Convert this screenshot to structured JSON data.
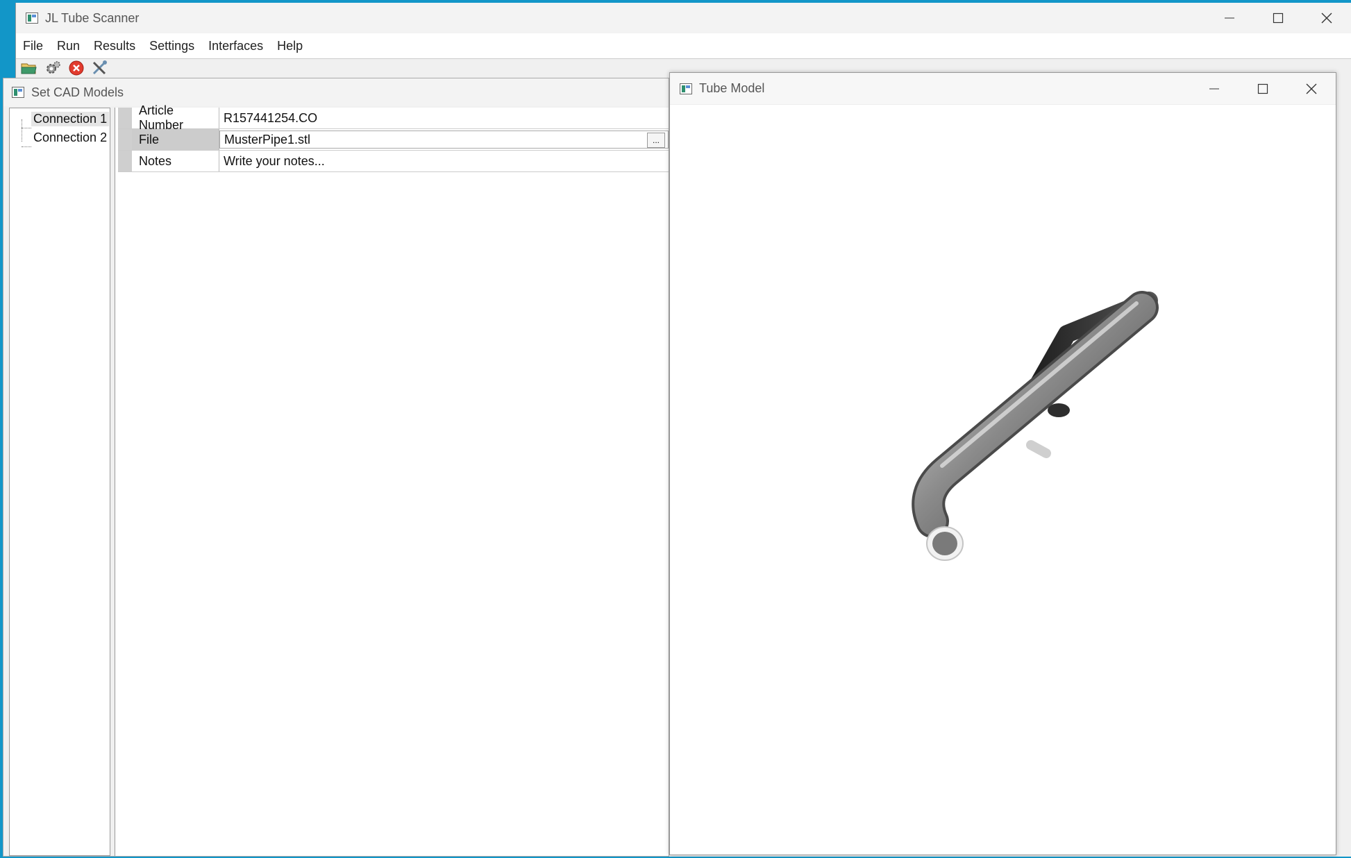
{
  "main_window": {
    "title": "JL Tube Scanner",
    "menu": [
      "File",
      "Run",
      "Results",
      "Settings",
      "Interfaces",
      "Help"
    ],
    "toolbar": [
      "open-folder-icon",
      "settings-gears-icon",
      "stop-icon",
      "tools-icon"
    ]
  },
  "cad_dialog": {
    "title": "Set CAD Models",
    "connections": [
      "Connection 1",
      "Connection 2"
    ],
    "properties": {
      "article_number": {
        "label": "Article Number",
        "value": "R157441254.CO"
      },
      "file": {
        "label": "File",
        "value": "MusterPipe1.stl",
        "browse_label": "..."
      },
      "notes": {
        "label": "Notes",
        "value": "Write your notes..."
      }
    }
  },
  "tube_window": {
    "title": "Tube Model",
    "viewport_content": "tube-3d-model"
  },
  "colors": {
    "desktop": "#1296c8",
    "tube_highlight": "#dcdcdc",
    "tube_shadow": "#2e2e2e"
  }
}
